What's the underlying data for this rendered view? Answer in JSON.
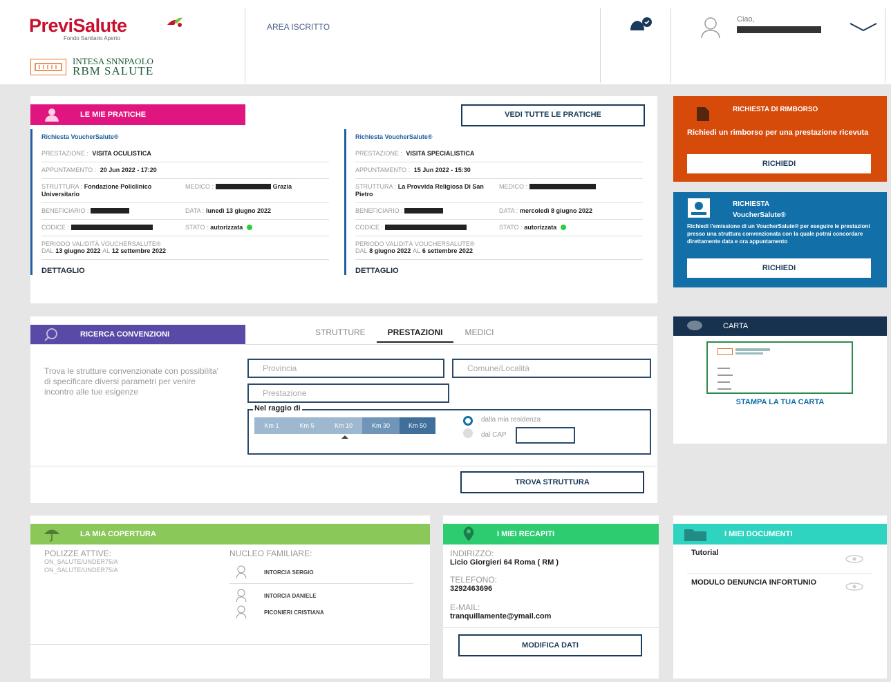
{
  "header": {
    "logo_main": "PreviSalute",
    "logo_sub": "Fondo Sanitario Aperto",
    "partner_line1": "INTESA SNNPAOLO",
    "partner_line2": "RBM SALUTE",
    "area_label": "AREA ISCRITTO",
    "greeting": "Ciao,"
  },
  "pratiche": {
    "title": "LE MIE PRATICHE",
    "view_all": "VEDI TUTTE LE PRATICHE",
    "items": [
      {
        "type": "Richiesta VoucherSalute®",
        "prestazione_label": "PRESTAZIONE :",
        "prestazione": "VISITA OCULISTICA",
        "appuntamento_label": "APPUNTAMENTO :",
        "appuntamento": "20 Jun 2022 - 17:20",
        "struttura_label": "STRUTTURA :",
        "struttura": "Fondazione Policlinico Universitario",
        "medico_label": "MEDICO :",
        "medico_suffix": "Grazia",
        "beneficiario_label": "BENEFICIARIO :",
        "data_label": "DATA :",
        "data": "lunedì 13 giugno 2022",
        "codice_label": "CODICE :",
        "stato_label": "STATO :",
        "stato": "autorizzata",
        "periodo_label": "PERIODO VALIDITÀ VoucherSalute®",
        "dal_label": "DAL",
        "dal": "13 giugno 2022",
        "al_label": "AL",
        "al": "12 settembre 2022",
        "dettaglio": "DETTAGLIO"
      },
      {
        "type": "Richiesta VoucherSalute®",
        "prestazione_label": "PRESTAZIONE :",
        "prestazione": "VISITA SPECIALISTICA",
        "appuntamento_label": "APPUNTAMENTO :",
        "appuntamento": "15 Jun 2022 - 15:30",
        "struttura_label": "STRUTTURA :",
        "struttura": "La Provvida Religiosa Di San Pietro",
        "medico_label": "MEDICO :",
        "medico_suffix": "",
        "beneficiario_label": "BENEFICIARIO :",
        "data_label": "DATA :",
        "data": "mercoledì 8 giugno 2022",
        "codice_label": "CODICE :",
        "stato_label": "STATO :",
        "stato": "autorizzata",
        "periodo_label": "PERIODO VALIDITÀ VoucherSalute®",
        "dal_label": "DAL",
        "dal": "8 giugno 2022",
        "al_label": "AL",
        "al": "6 settembre 2022",
        "dettaglio": "DETTAGLIO"
      }
    ]
  },
  "rimborso": {
    "title": "RICHIESTA DI RIMBORSO",
    "text": "Richiedi un rimborso per una prestazione ricevuta",
    "button": "RICHIEDI"
  },
  "voucher": {
    "title": "RICHIESTA VoucherSalute®",
    "text": "Richiedi l'emissione di un VoucherSalute® per eseguire le prestazioni presso una struttura convenzionata con la quale potrai concordare direttamente data e ora appuntamento",
    "button": "RICHIEDI"
  },
  "ricerca": {
    "title": "RICERCA CONVENZIONI",
    "tabs": [
      "STRUTTURE",
      "PRESTAZIONI",
      "MEDICI"
    ],
    "active_tab": "PRESTAZIONI",
    "description": "Trova le strutture convenzionate con possibilita' di specificare diversi parametri per venire incontro alle tue esigenze",
    "provincia_placeholder": "Provincia",
    "comune_placeholder": "Comune/Località",
    "prestazione_placeholder": "Prestazione",
    "radius_label": "Nel raggio di",
    "radius_options": [
      "Km 1",
      "Km 5",
      "Km 10",
      "Km 30",
      "Km 50"
    ],
    "radius_selected": "Km 50",
    "origin_options": [
      "dalla mia residenza",
      "dal CAP"
    ],
    "origin_selected": "dalla mia residenza",
    "button": "TROVA STRUTTURA"
  },
  "carta": {
    "title": "CARTA",
    "link": "STAMPA LA TUA CARTA"
  },
  "copertura": {
    "title": "LA MIA COPERTURA",
    "polizze_label": "POLIZZE ATTIVE:",
    "polizze": [
      "ON_SALUTE/UNDER75/A",
      "ON_SALUTE/UNDER75/A"
    ],
    "nucleo_label": "NUCLEO FAMILIARE:",
    "nucleo": [
      "INTORCIA SERGIO",
      "INTORCIA DANIELE",
      "PICONIERI CRISTIANA"
    ]
  },
  "recapiti": {
    "title": "I MIEI RECAPITI",
    "indirizzo_label": "INDIRIZZO:",
    "indirizzo": "Licio Giorgieri 64 Roma ( RM )",
    "telefono_label": "TELEFONO:",
    "telefono": "3292463696",
    "email_label": "E-MAIL:",
    "email": "tranquillamente@ymail.com",
    "button": "MODIFICA DATI"
  },
  "documenti": {
    "title": "I MIEI DOCUMENTI",
    "items": [
      "Tutorial",
      "MODULO DENUNCIA INFORTUNIO"
    ]
  },
  "colors": {
    "pink": "#e0157f",
    "purple": "#5a4aa8",
    "orange": "#d64a0a",
    "blue": "#136fa8",
    "navy": "#1a3a5a",
    "green_light": "#8ac85a",
    "green": "#2ecc71",
    "teal": "#2ed4c0"
  }
}
